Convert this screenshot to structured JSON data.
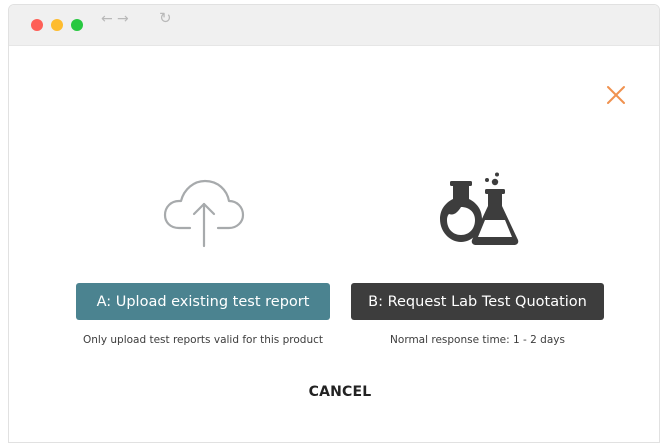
{
  "window": {
    "controls": [
      "close",
      "minimize",
      "zoom"
    ],
    "nav_back": "←",
    "nav_forward": "→",
    "reload": "↻"
  },
  "dialog": {
    "close_icon": "close-icon",
    "accent_color": "#f0924f",
    "options": [
      {
        "icon": "cloud-upload-icon",
        "button_label": "A: Upload existing test report",
        "note": "Only upload test reports valid for this product",
        "button_color": "#4b8390"
      },
      {
        "icon": "lab-flasks-icon",
        "button_label": "B: Request Lab Test Quotation",
        "note": "Normal response time: 1 - 2 days",
        "button_color": "#3d3d3d"
      }
    ],
    "cancel_label": "CANCEL"
  }
}
